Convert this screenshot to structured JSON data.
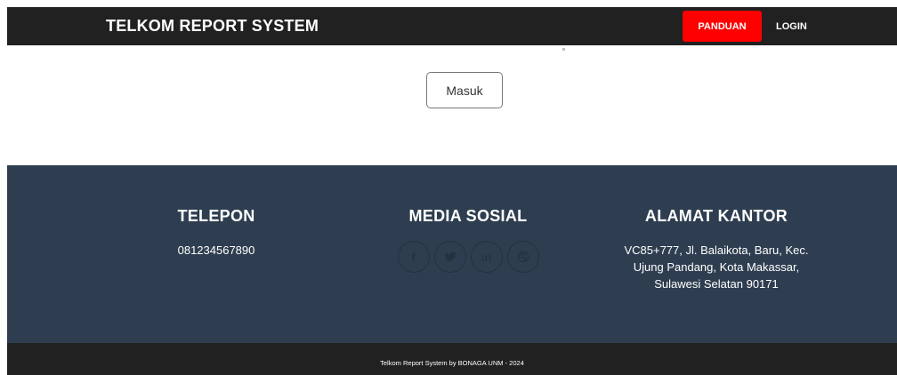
{
  "navbar": {
    "brand": "TELKOM REPORT SYSTEM",
    "panduan_label": "PANDUAN",
    "login_label": "LOGIN"
  },
  "main": {
    "masuk_label": "Masuk"
  },
  "footer": {
    "telepon": {
      "title": "TELEPON",
      "value": "081234567890"
    },
    "media_sosial": {
      "title": "MEDIA SOSIAL",
      "icons": [
        "facebook-icon",
        "twitter-icon",
        "linkedin-icon",
        "dribbble-icon"
      ]
    },
    "alamat": {
      "title": "ALAMAT KANTOR",
      "line1": "VC85+777, Jl. Balaikota, Baru, Kec.",
      "line2": "Ujung Pandang, Kota Makassar,",
      "line3": "Sulawesi Selatan 90171"
    },
    "credit": "Telkom Report System by BONAGA UNM - 2024"
  },
  "colors": {
    "navbar_bg": "#212121",
    "accent_red": "#ff0000",
    "footer_bg": "#2e3e50",
    "bottom_bg": "#212121"
  }
}
